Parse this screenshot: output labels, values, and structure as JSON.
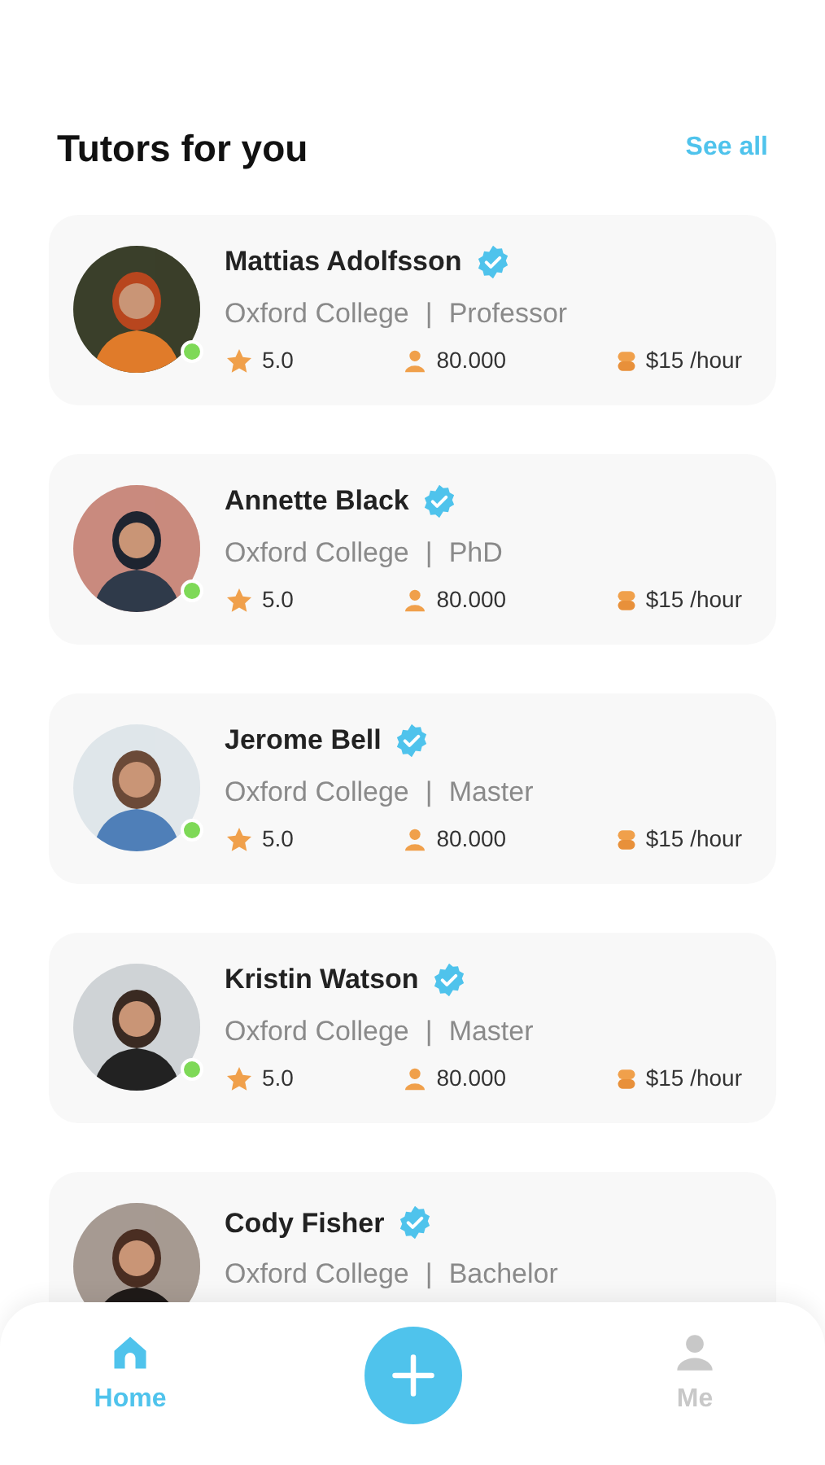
{
  "header": {
    "title": "Tutors for you",
    "link": "See all"
  },
  "tutors": [
    {
      "name": "Mattias Adolfsson",
      "verified": true,
      "online": true,
      "school": "Oxford College",
      "separator": "|",
      "degree": "Professor",
      "stats": {
        "rating": "5.0",
        "students": "80.000",
        "price": "$15 /hour"
      }
    },
    {
      "name": "Annette Black",
      "verified": true,
      "online": true,
      "school": "Oxford College",
      "separator": "|",
      "degree": "PhD",
      "stats": {
        "rating": "5.0",
        "students": "80.000",
        "price": "$15 /hour"
      }
    },
    {
      "name": "Jerome Bell",
      "verified": true,
      "online": true,
      "school": "Oxford College",
      "separator": "|",
      "degree": "Master",
      "stats": {
        "rating": "5.0",
        "students": "80.000",
        "price": "$15 /hour"
      }
    },
    {
      "name": "Kristin Watson",
      "verified": true,
      "online": true,
      "school": "Oxford College",
      "separator": "|",
      "degree": "Master",
      "stats": {
        "rating": "5.0",
        "students": "80.000",
        "price": "$15 /hour"
      }
    },
    {
      "name": "Cody Fisher",
      "verified": true,
      "online": false,
      "school": "Oxford College",
      "separator": "|",
      "degree": "Bachelor"
    }
  ],
  "nav": [
    {
      "kind": "home",
      "label": "Home",
      "selected": true
    },
    {
      "kind": "add"
    },
    {
      "kind": "me",
      "label": "Me",
      "selected": false
    }
  ]
}
